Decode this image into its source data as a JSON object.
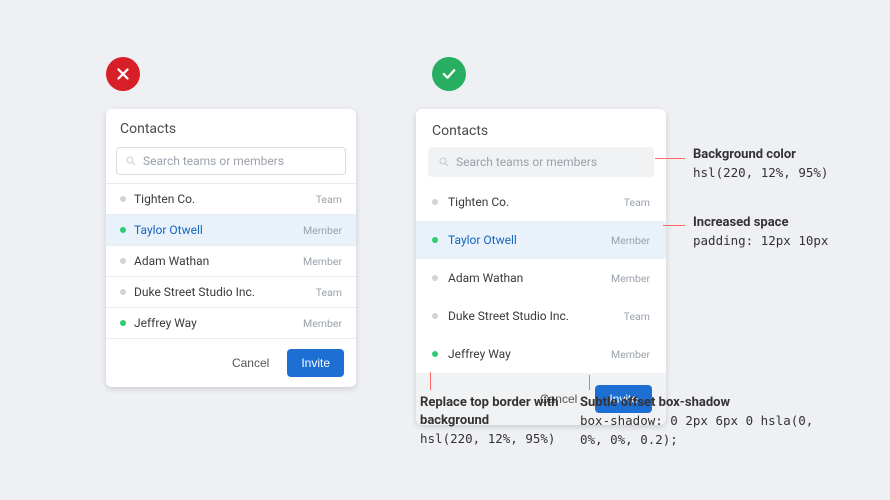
{
  "badges": {
    "bad": "x",
    "good": "check"
  },
  "card": {
    "title": "Contacts",
    "search_placeholder": "Search teams or members",
    "rows": [
      {
        "name": "Tighten Co.",
        "role": "Team",
        "status": "gray",
        "selected": false
      },
      {
        "name": "Taylor Otwell",
        "role": "Member",
        "status": "green",
        "selected": true
      },
      {
        "name": "Adam Wathan",
        "role": "Member",
        "status": "gray",
        "selected": false
      },
      {
        "name": "Duke Street Studio Inc.",
        "role": "Team",
        "status": "gray",
        "selected": false
      },
      {
        "name": "Jeffrey Way",
        "role": "Member",
        "status": "green",
        "selected": false
      }
    ],
    "cancel_label": "Cancel",
    "invite_label": "Invite"
  },
  "annotations": {
    "bgcolor": {
      "title": "Background color",
      "code": "hsl(220, 12%, 95%)"
    },
    "padding": {
      "title": "Increased space",
      "code": "padding: 12px 10px"
    },
    "footer": {
      "title": "Replace top border with background",
      "code": "hsl(220, 12%, 95%)"
    },
    "shadow": {
      "title": "Subtle offset box-shadow",
      "code": "box-shadow: 0 2px 6px 0 hsla(0, 0%, 0%, 0.2);"
    }
  }
}
